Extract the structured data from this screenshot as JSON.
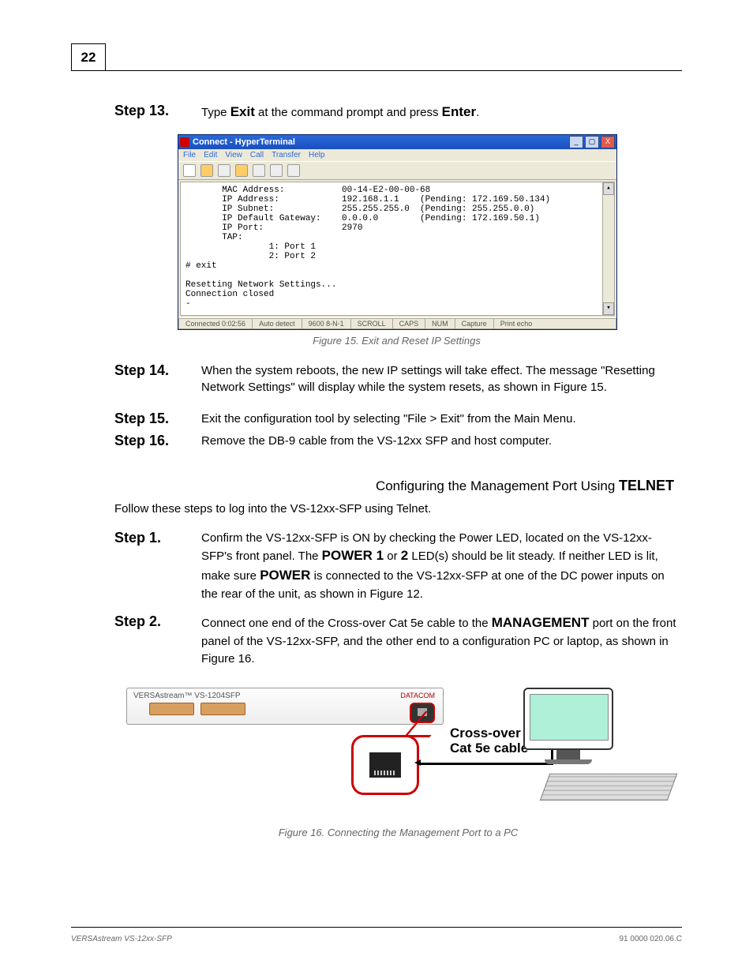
{
  "page_number": "22",
  "steps": {
    "s13": {
      "label": "Step 13.",
      "pre": "Type ",
      "bold1": "Exit",
      "mid": " at the command prompt and press ",
      "bold2": "Enter",
      "post": "."
    },
    "s14": {
      "label": "Step 14.",
      "text": "When the system reboots, the new IP settings will take effect. The message \"Resetting Network Settings\" will display while the system resets, as shown in Figure 15."
    },
    "s15": {
      "label": "Step 15.",
      "text": "Exit the configuration tool by selecting \"File > Exit\" from the Main Menu."
    },
    "s16": {
      "label": "Step 16.",
      "text": "Remove the DB-9 cable from the VS-12xx SFP and host computer."
    }
  },
  "terminal": {
    "title": "Connect - HyperTerminal",
    "menu": [
      "File",
      "Edit",
      "View",
      "Call",
      "Transfer",
      "Help"
    ],
    "body": "       MAC Address:           00-14-E2-00-00-68\n       IP Address:            192.168.1.1    (Pending: 172.169.50.134)\n       IP Subnet:             255.255.255.0  (Pending: 255.255.0.0)\n       IP Default Gateway:    0.0.0.0        (Pending: 172.169.50.1)\n       IP Port:               2970\n       TAP:\n                1: Port 1\n                2: Port 2\n# exit\n\nResetting Network Settings...\nConnection closed\n-",
    "status": [
      "Connected 0:02:56",
      "Auto detect",
      "9600 8-N-1",
      "SCROLL",
      "CAPS",
      "NUM",
      "Capture",
      "Print echo"
    ]
  },
  "figure_caption": "Figure 15. Exit and Reset IP Settings",
  "section_title_pre": "Configuring the Management Port Using ",
  "section_title_bold": "TELNET",
  "section_body": "Follow these steps to log into the VS-12xx-SFP using Telnet.",
  "step1": {
    "label": "Step 1.",
    "line1": "Confirm the VS-12xx-SFP is ON by checking the Power LED, located on the ",
    "line2_pre": "VS-12xx-SFP's front panel. The ",
    "line2_b1": "POWER 1",
    "line2_mid": " or ",
    "line2_b2": "2",
    "line2_post": " LED(s) should be lit steady. If ",
    "line3_pre": "neither LED is lit, make sure ",
    "line3_b": "POWER",
    "line3_post": " is connected to the VS-12xx-SFP at one ",
    "line4": "of the DC power inputs on the rear of the unit, as shown in Figure 12."
  },
  "step2": {
    "label": "Step 2.",
    "l1_pre": "Connect one end of the Cross-over Cat 5e cable to the ",
    "l1_b": "MANAGEMENT",
    "l2": "port on the front panel of the VS-12xx-SFP, and the other end to a ",
    "l3": "configuration PC or laptop, as shown in Figure 16."
  },
  "diagram": {
    "device_label": "VERSAstream™  VS-1204SFP",
    "logo": "DATACOM",
    "cable_label_1": "Cross-over",
    "cable_label_2": "Cat 5e cable"
  },
  "figure16_caption": "Figure 16. Connecting the Management Port to a PC",
  "footer_left": "VERSAstream VS-12xx-SFP",
  "footer_right": "91 0000 020.06.C"
}
